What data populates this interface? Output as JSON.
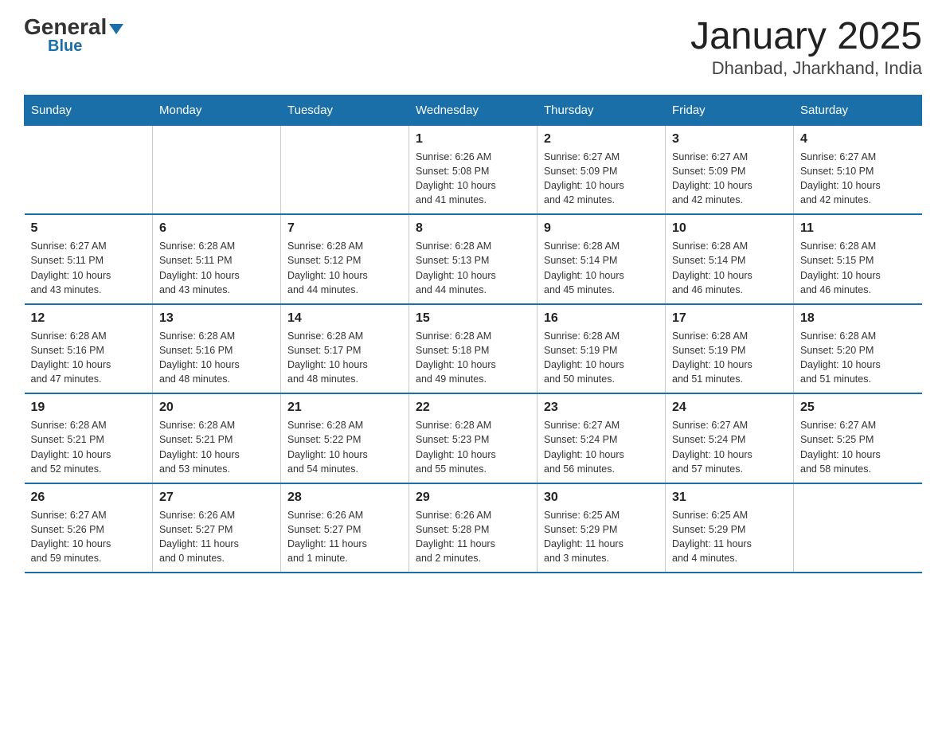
{
  "header": {
    "logo_general": "General",
    "logo_blue": "Blue",
    "title": "January 2025",
    "subtitle": "Dhanbad, Jharkhand, India"
  },
  "days_of_week": [
    "Sunday",
    "Monday",
    "Tuesday",
    "Wednesday",
    "Thursday",
    "Friday",
    "Saturday"
  ],
  "weeks": [
    [
      {
        "day": "",
        "info": ""
      },
      {
        "day": "",
        "info": ""
      },
      {
        "day": "",
        "info": ""
      },
      {
        "day": "1",
        "info": "Sunrise: 6:26 AM\nSunset: 5:08 PM\nDaylight: 10 hours\nand 41 minutes."
      },
      {
        "day": "2",
        "info": "Sunrise: 6:27 AM\nSunset: 5:09 PM\nDaylight: 10 hours\nand 42 minutes."
      },
      {
        "day": "3",
        "info": "Sunrise: 6:27 AM\nSunset: 5:09 PM\nDaylight: 10 hours\nand 42 minutes."
      },
      {
        "day": "4",
        "info": "Sunrise: 6:27 AM\nSunset: 5:10 PM\nDaylight: 10 hours\nand 42 minutes."
      }
    ],
    [
      {
        "day": "5",
        "info": "Sunrise: 6:27 AM\nSunset: 5:11 PM\nDaylight: 10 hours\nand 43 minutes."
      },
      {
        "day": "6",
        "info": "Sunrise: 6:28 AM\nSunset: 5:11 PM\nDaylight: 10 hours\nand 43 minutes."
      },
      {
        "day": "7",
        "info": "Sunrise: 6:28 AM\nSunset: 5:12 PM\nDaylight: 10 hours\nand 44 minutes."
      },
      {
        "day": "8",
        "info": "Sunrise: 6:28 AM\nSunset: 5:13 PM\nDaylight: 10 hours\nand 44 minutes."
      },
      {
        "day": "9",
        "info": "Sunrise: 6:28 AM\nSunset: 5:14 PM\nDaylight: 10 hours\nand 45 minutes."
      },
      {
        "day": "10",
        "info": "Sunrise: 6:28 AM\nSunset: 5:14 PM\nDaylight: 10 hours\nand 46 minutes."
      },
      {
        "day": "11",
        "info": "Sunrise: 6:28 AM\nSunset: 5:15 PM\nDaylight: 10 hours\nand 46 minutes."
      }
    ],
    [
      {
        "day": "12",
        "info": "Sunrise: 6:28 AM\nSunset: 5:16 PM\nDaylight: 10 hours\nand 47 minutes."
      },
      {
        "day": "13",
        "info": "Sunrise: 6:28 AM\nSunset: 5:16 PM\nDaylight: 10 hours\nand 48 minutes."
      },
      {
        "day": "14",
        "info": "Sunrise: 6:28 AM\nSunset: 5:17 PM\nDaylight: 10 hours\nand 48 minutes."
      },
      {
        "day": "15",
        "info": "Sunrise: 6:28 AM\nSunset: 5:18 PM\nDaylight: 10 hours\nand 49 minutes."
      },
      {
        "day": "16",
        "info": "Sunrise: 6:28 AM\nSunset: 5:19 PM\nDaylight: 10 hours\nand 50 minutes."
      },
      {
        "day": "17",
        "info": "Sunrise: 6:28 AM\nSunset: 5:19 PM\nDaylight: 10 hours\nand 51 minutes."
      },
      {
        "day": "18",
        "info": "Sunrise: 6:28 AM\nSunset: 5:20 PM\nDaylight: 10 hours\nand 51 minutes."
      }
    ],
    [
      {
        "day": "19",
        "info": "Sunrise: 6:28 AM\nSunset: 5:21 PM\nDaylight: 10 hours\nand 52 minutes."
      },
      {
        "day": "20",
        "info": "Sunrise: 6:28 AM\nSunset: 5:21 PM\nDaylight: 10 hours\nand 53 minutes."
      },
      {
        "day": "21",
        "info": "Sunrise: 6:28 AM\nSunset: 5:22 PM\nDaylight: 10 hours\nand 54 minutes."
      },
      {
        "day": "22",
        "info": "Sunrise: 6:28 AM\nSunset: 5:23 PM\nDaylight: 10 hours\nand 55 minutes."
      },
      {
        "day": "23",
        "info": "Sunrise: 6:27 AM\nSunset: 5:24 PM\nDaylight: 10 hours\nand 56 minutes."
      },
      {
        "day": "24",
        "info": "Sunrise: 6:27 AM\nSunset: 5:24 PM\nDaylight: 10 hours\nand 57 minutes."
      },
      {
        "day": "25",
        "info": "Sunrise: 6:27 AM\nSunset: 5:25 PM\nDaylight: 10 hours\nand 58 minutes."
      }
    ],
    [
      {
        "day": "26",
        "info": "Sunrise: 6:27 AM\nSunset: 5:26 PM\nDaylight: 10 hours\nand 59 minutes."
      },
      {
        "day": "27",
        "info": "Sunrise: 6:26 AM\nSunset: 5:27 PM\nDaylight: 11 hours\nand 0 minutes."
      },
      {
        "day": "28",
        "info": "Sunrise: 6:26 AM\nSunset: 5:27 PM\nDaylight: 11 hours\nand 1 minute."
      },
      {
        "day": "29",
        "info": "Sunrise: 6:26 AM\nSunset: 5:28 PM\nDaylight: 11 hours\nand 2 minutes."
      },
      {
        "day": "30",
        "info": "Sunrise: 6:25 AM\nSunset: 5:29 PM\nDaylight: 11 hours\nand 3 minutes."
      },
      {
        "day": "31",
        "info": "Sunrise: 6:25 AM\nSunset: 5:29 PM\nDaylight: 11 hours\nand 4 minutes."
      },
      {
        "day": "",
        "info": ""
      }
    ]
  ]
}
